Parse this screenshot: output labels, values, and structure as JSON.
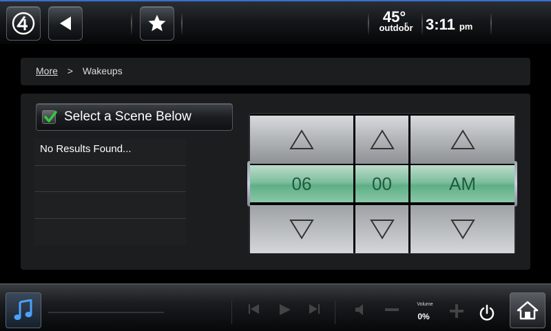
{
  "topbar": {
    "temperature": "45",
    "degree_symbol": "°",
    "temperature_unit": "F",
    "temperature_label": "outdoor",
    "time": "3:11",
    "time_suffix": "pm"
  },
  "breadcrumb": {
    "parent": "More",
    "separator": ">",
    "current": "Wakeups"
  },
  "scene_selector": {
    "label": "Select a Scene Below",
    "checked": true
  },
  "results": {
    "rows": [
      "No Results Found...",
      "",
      "",
      ""
    ]
  },
  "time_picker": {
    "hour": "06",
    "minute": "00",
    "period": "AM"
  },
  "bottombar": {
    "volume_label": "Volume",
    "volume_value": "0%"
  },
  "icons": {
    "logo": "control4-logo-icon",
    "back": "back-arrow-icon",
    "favorite": "star-icon",
    "music": "music-note-icon",
    "home": "home-icon",
    "power": "power-icon"
  },
  "colors": {
    "accent_top_border": "#3a6fd0",
    "picker_band": "#7fbf9f",
    "picker_text": "#1f5a3f",
    "check_green": "#2ecc40"
  }
}
